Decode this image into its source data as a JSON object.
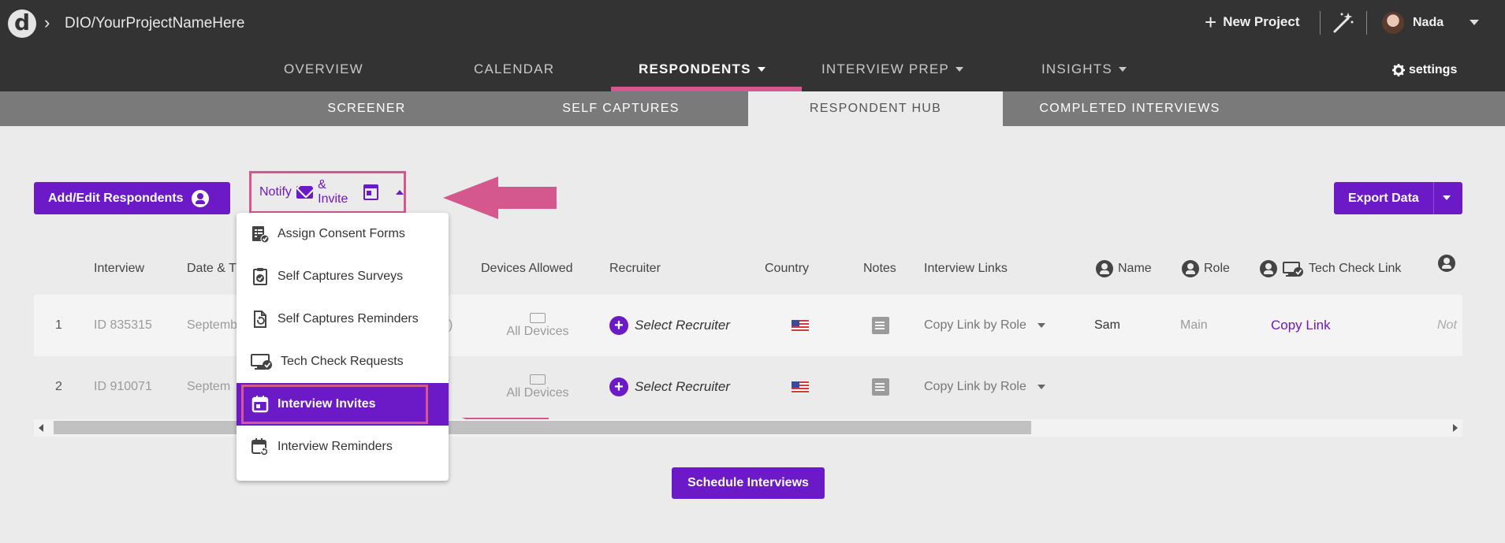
{
  "header": {
    "breadcrumb": "DIO/YourProjectNameHere",
    "new_project": "New Project",
    "user_name": "Nada"
  },
  "nav": {
    "items": [
      {
        "label": "OVERVIEW"
      },
      {
        "label": "CALENDAR"
      },
      {
        "label": "RESPONDENTS",
        "active": true
      },
      {
        "label": "INTERVIEW PREP"
      },
      {
        "label": "INSIGHTS"
      }
    ],
    "settings": "settings"
  },
  "subnav": {
    "items": [
      {
        "label": "SCREENER"
      },
      {
        "label": "SELF CAPTURES"
      },
      {
        "label": "RESPONDENT HUB",
        "active": true
      },
      {
        "label": "COMPLETED INTERVIEWS"
      }
    ]
  },
  "toolbar": {
    "add_edit": "Add/Edit Respondents",
    "notify": "Notify",
    "invite": "& Invite",
    "export": "Export Data"
  },
  "dropdown": {
    "items": [
      {
        "label": "Assign Consent Forms",
        "icon": "consent-forms-icon"
      },
      {
        "label": "Self Captures Surveys",
        "icon": "survey-icon"
      },
      {
        "label": "Self Captures Reminders",
        "icon": "reminder-doc-icon"
      },
      {
        "label": "Tech Check Requests",
        "icon": "monitor-check-icon"
      },
      {
        "label": "Interview Invites",
        "icon": "calendar-icon",
        "selected": true
      },
      {
        "label": "Interview Reminders",
        "icon": "calendar-refresh-icon"
      }
    ]
  },
  "table": {
    "headers": {
      "interview": "Interview",
      "date": "Date & T",
      "devices": "Devices Allowed",
      "recruiter": "Recruiter",
      "country": "Country",
      "notes": "Notes",
      "links": "Interview Links",
      "name": "Name",
      "role": "Role",
      "tech_check": "Tech Check Link"
    },
    "rows": [
      {
        "num": "1",
        "id": "ID 835315",
        "date": "Septemb",
        "date_tail": ")",
        "devices": "All Devices",
        "recruiter": "Select Recruiter",
        "links": "Copy Link by Role",
        "name": "Sam",
        "role": "Main",
        "tech_check": "Copy Link",
        "extra": "Not"
      },
      {
        "num": "2",
        "id": "ID 910071",
        "date": "Septem",
        "date_tail": "",
        "devices": "All Devices",
        "recruiter": "Select Recruiter",
        "links": "Copy Link by Role"
      }
    ]
  },
  "schedule_button": "Schedule Interviews",
  "colors": {
    "accent": "#6c19c7",
    "highlight": "#d4588e",
    "topbar": "#333333"
  }
}
